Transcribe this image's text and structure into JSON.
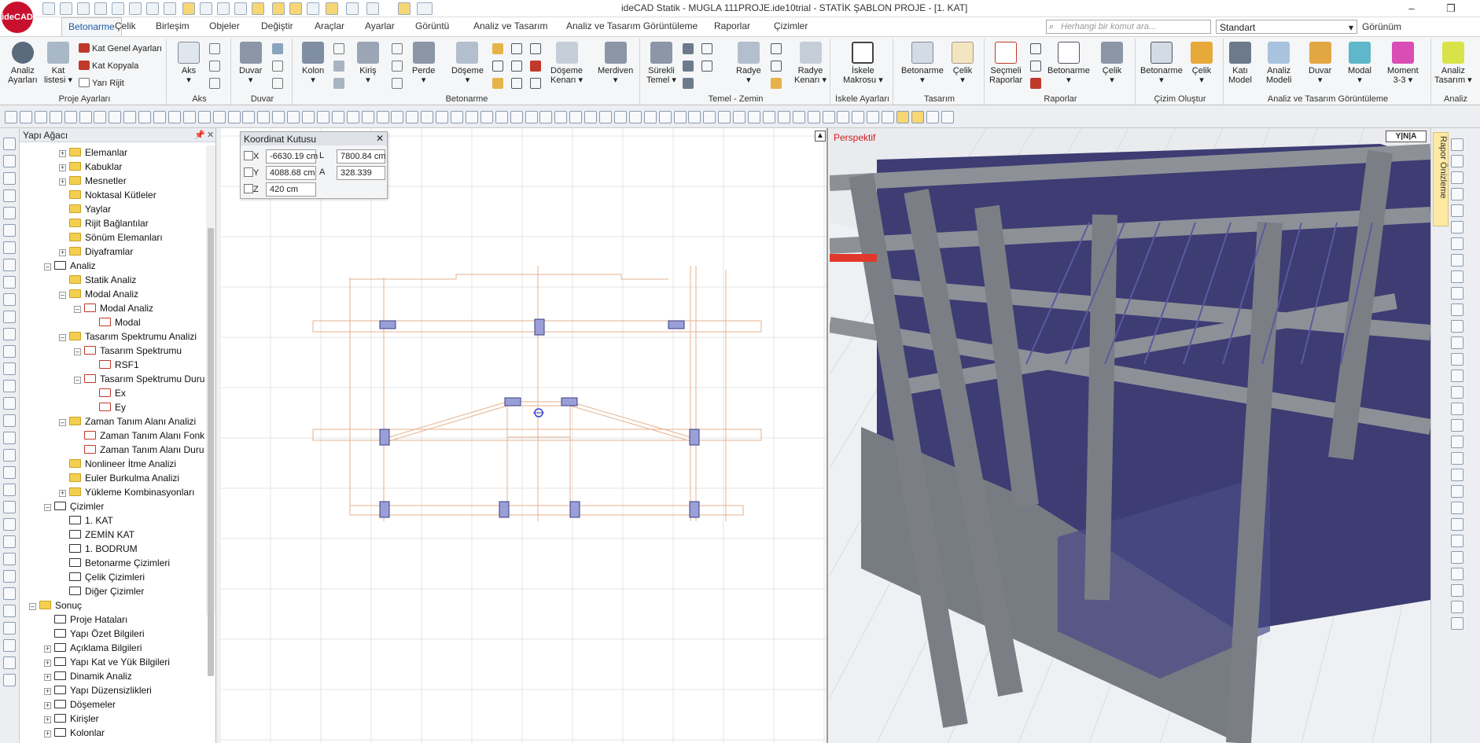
{
  "window": {
    "title": "ideCAD Statik - MUGLA 111PROJE.ide10trial - STATİK ŞABLON PROJE - [1. KAT]",
    "logo": "ideCAD",
    "minimize": "–",
    "restore": "❐",
    "close": "✕"
  },
  "tabs": [
    "Betonarme",
    "Çelik",
    "Birleşim",
    "Objeler",
    "Değiştir",
    "Araçlar",
    "Ayarlar",
    "Görüntü",
    "Analiz ve Tasarım",
    "Analiz ve Tasarım Görüntüleme",
    "Raporlar",
    "Çizimler"
  ],
  "search": {
    "placeholder": "Herhangi bir komut ara..."
  },
  "view_select": "Standart",
  "gorunum_label": "Görünüm",
  "ribbon": {
    "groups": [
      {
        "label": "Proje Ayarları"
      },
      {
        "label": "Aks"
      },
      {
        "label": "Duvar"
      },
      {
        "label": "Betonarme"
      },
      {
        "label": "Temel - Zemin"
      },
      {
        "label": "İskele Ayarları"
      },
      {
        "label": "Tasarım"
      },
      {
        "label": "Raporlar"
      },
      {
        "label": "Çizim Oluştur"
      },
      {
        "label": "Analiz ve Tasarım Görüntüleme"
      },
      {
        "label": "Analiz"
      }
    ],
    "proje_small": [
      "Kat Genel Ayarları",
      "Kat Kopyala",
      "Yarı Rijit"
    ],
    "buttons": {
      "analiz_ayarlari": "Analiz\nAyarları",
      "kat_listesi": "Kat\nlistesi ▾",
      "aks": "Aks\n▾",
      "duvar": "Duvar\n▾",
      "kolon": "Kolon\n▾",
      "kiris": "Kiriş\n▾",
      "perde": "Perde\n▾",
      "doseme": "Döşeme\n▾",
      "doseme_kenari": "Döşeme\nKenarı ▾",
      "merdiven": "Merdiven\n▾",
      "surekli_temel": "Sürekli\nTemel ▾",
      "radye": "Radye\n▾",
      "radye_kenari": "Radye\nKenarı ▾",
      "iskele_makrosu": "İskele\nMakrosu ▾",
      "tasarim_betonarme": "Betonarme\n▾",
      "tasarim_celik": "Çelik\n▾",
      "secmeli_raporlar": "Seçmeli\nRaporlar",
      "rapor_betonarme": "Betonarme\n▾",
      "rapor_celik": "Çelik\n▾",
      "cizim_betonarme": "Betonarme\n▾",
      "cizim_celik": "Çelik\n▾",
      "kati_model": "Katı\nModel",
      "analiz_modeli": "Analiz\nModeli",
      "duvar_g": "Duvar\n▾",
      "modal": "Modal\n▾",
      "moment": "Moment\n3-3 ▾",
      "analiz_tasarim": "Analiz\nTasarım ▾"
    }
  },
  "tree": {
    "title": "Yapı Ağacı",
    "pin": "📌",
    "close": "✕",
    "items": [
      {
        "label": "Elemanlar",
        "icon": "folder"
      },
      {
        "label": "Kabuklar",
        "icon": "folder"
      },
      {
        "label": "Mesnetler",
        "icon": "folder"
      },
      {
        "label": "Noktasal Kütleler",
        "icon": "folder"
      },
      {
        "label": "Yaylar",
        "icon": "folder"
      },
      {
        "label": "Rijit Bağlantılar",
        "icon": "folder"
      },
      {
        "label": "Sönüm Elemanları",
        "icon": "folder"
      },
      {
        "label": "Diyaframlar",
        "icon": "folder"
      },
      {
        "label": "Analiz",
        "icon": "analysis"
      },
      {
        "label": "Statik Analiz",
        "icon": "folder"
      },
      {
        "label": "Modal Analiz",
        "icon": "folder"
      },
      {
        "label": "Modal Analiz",
        "icon": "modal"
      },
      {
        "label": "Modal",
        "icon": "modal"
      },
      {
        "label": "Tasarım Spektrumu Analizi",
        "icon": "folder"
      },
      {
        "label": "Tasarım Spektrumu",
        "icon": "chart"
      },
      {
        "label": "RSF1",
        "icon": "chart"
      },
      {
        "label": "Tasarım Spektrumu Duru",
        "icon": "chart"
      },
      {
        "label": "Ex",
        "icon": "chart"
      },
      {
        "label": "Ey",
        "icon": "chart"
      },
      {
        "label": "Zaman Tanım Alanı Analizi",
        "icon": "folder"
      },
      {
        "label": "Zaman Tanım Alanı Fonk",
        "icon": "chart"
      },
      {
        "label": "Zaman Tanım Alanı Duru",
        "icon": "chart"
      },
      {
        "label": "Nonlineer İtme Analizi",
        "icon": "folder"
      },
      {
        "label": "Euler Burkulma Analizi",
        "icon": "folder"
      },
      {
        "label": "Yükleme Kombinasyonları",
        "icon": "folder"
      },
      {
        "label": "Çizimler",
        "icon": "drawing"
      },
      {
        "label": "1. KAT",
        "icon": "doc"
      },
      {
        "label": "ZEMİN KAT",
        "icon": "doc"
      },
      {
        "label": "1. BODRUM",
        "icon": "doc"
      },
      {
        "label": "Betonarme Çizimleri",
        "icon": "drawing"
      },
      {
        "label": "Çelik Çizimleri",
        "icon": "drawing"
      },
      {
        "label": "Diğer Çizimler",
        "icon": "drawing"
      },
      {
        "label": "Sonuç",
        "icon": "folder"
      },
      {
        "label": "Proje Hataları",
        "icon": "doc"
      },
      {
        "label": "Yapı Özet Bilgileri",
        "icon": "doc"
      },
      {
        "label": "Açıklama Bilgileri",
        "icon": "doc"
      },
      {
        "label": "Yapı Kat ve Yük Bilgileri",
        "icon": "doc"
      },
      {
        "label": "Dinamik Analiz",
        "icon": "doc"
      },
      {
        "label": "Yapı Düzensizlikleri",
        "icon": "doc"
      },
      {
        "label": "Döşemeler",
        "icon": "doc"
      },
      {
        "label": "Kirişler",
        "icon": "doc"
      },
      {
        "label": "Kolonlar",
        "icon": "doc"
      }
    ]
  },
  "coord_box": {
    "title": "Koordinat Kutusu",
    "close": "✕",
    "x_label": "X",
    "x": "-6630.19 cm",
    "y_label": "Y",
    "y": "4088.68 cm",
    "z_label": "Z",
    "z": "420 cm",
    "l_label": "L",
    "l": "7800.84 cm",
    "a_label": "A",
    "a": "328.339"
  },
  "perspective": {
    "label": "Perspektif",
    "nav": "Y|N|A"
  },
  "rapor_onizleme": "Rapor Önizleme",
  "colors": {
    "accent": "#1e5aa8",
    "column": "#9a9fd8",
    "slab": "#4b4a8a",
    "concrete": "#7a7f85"
  }
}
